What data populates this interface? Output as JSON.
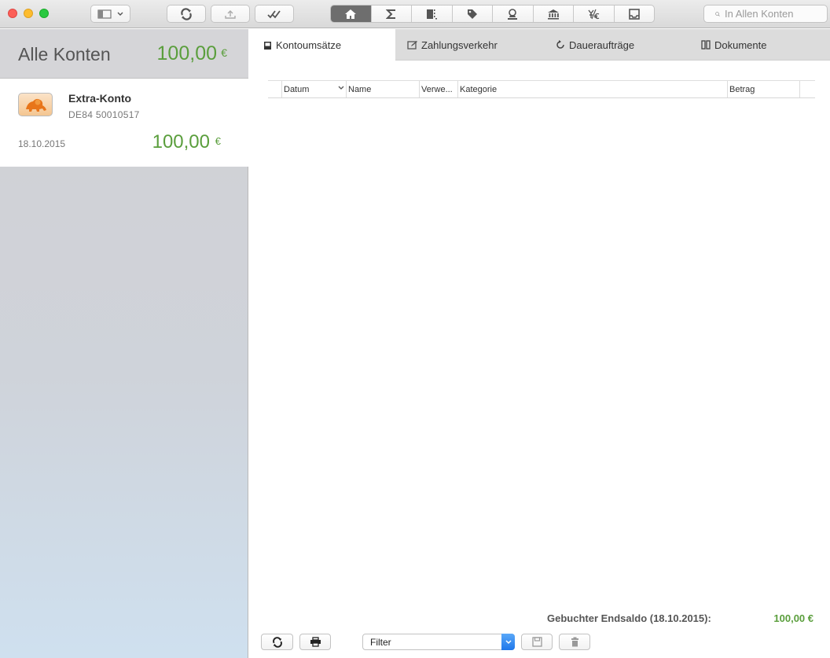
{
  "search": {
    "placeholder": "In Allen Konten"
  },
  "sidebar": {
    "all_accounts_title": "Alle Konten",
    "all_accounts_amount": "100,00",
    "currency": "€",
    "accounts": [
      {
        "name": "Extra-Konto",
        "iban": "DE84 50010517",
        "date": "18.10.2015",
        "amount": "100,00",
        "currency": "€"
      }
    ]
  },
  "tabs": [
    {
      "label": "Kontoumsätze",
      "active": true
    },
    {
      "label": "Zahlungsverkehr",
      "active": false
    },
    {
      "label": "Daueraufträge",
      "active": false
    },
    {
      "label": "Dokumente",
      "active": false
    }
  ],
  "table": {
    "columns": [
      "Datum",
      "Name",
      "Verwe...",
      "Kategorie",
      "Betrag"
    ],
    "rows": []
  },
  "footer": {
    "saldo_label": "Gebuchter Endsaldo (18.10.2015):",
    "saldo_value": "100,00 €",
    "filter_value": "Filter"
  },
  "colors": {
    "positive": "#5a9e3c",
    "accent": "#1f77ea"
  }
}
